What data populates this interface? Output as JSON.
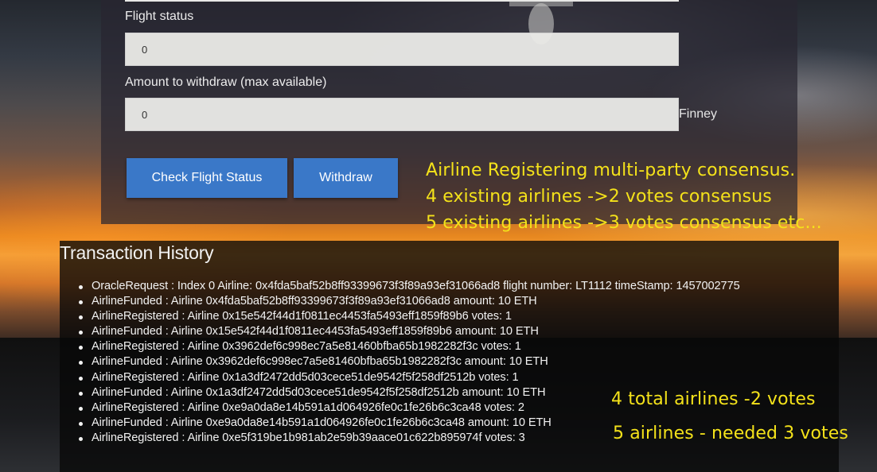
{
  "form": {
    "flight_status_label": "Flight status",
    "flight_status_value": "0",
    "withdraw_label": "Amount to withdraw (max available)",
    "withdraw_value": "0",
    "withdraw_unit": "Finney",
    "check_button_label": "Check Flight Status",
    "withdraw_button_label": "Withdraw"
  },
  "annotations": {
    "consensus_lines": [
      "Airline Registering multi-party consensus.",
      "4 existing airlines ->2 votes consensus",
      "5 existing airlines ->3 votes consensus etc..."
    ],
    "note_four": "4 total airlines -2 votes",
    "note_five": "5 airlines - needed 3 votes"
  },
  "history": {
    "title": "Transaction History",
    "items": [
      "OracleRequest : Index 0 Airline: 0x4fda5baf52b8ff93399673f3f89a93ef31066ad8 flight number: LT1112 timeStamp: 1457002775",
      "AirlineFunded : Airline 0x4fda5baf52b8ff93399673f3f89a93ef31066ad8 amount: 10 ETH",
      "AirlineRegistered : Airline 0x15e542f44d1f0811ec4453fa5493eff1859f89b6 votes: 1",
      "AirlineFunded : Airline 0x15e542f44d1f0811ec4453fa5493eff1859f89b6 amount: 10 ETH",
      "AirlineRegistered : Airline 0x3962def6c998ec7a5e81460bfba65b1982282f3c votes: 1",
      "AirlineFunded : Airline 0x3962def6c998ec7a5e81460bfba65b1982282f3c amount: 10 ETH",
      "AirlineRegistered : Airline 0x1a3df2472dd5d03cece51de9542f5f258df2512b votes: 1",
      "AirlineFunded : Airline 0x1a3df2472dd5d03cece51de9542f5f258df2512b amount: 10 ETH",
      "AirlineRegistered : Airline 0xe9a0da8e14b591a1d064926fe0c1fe26b6c3ca48 votes: 2",
      "AirlineFunded : Airline 0xe9a0da8e14b591a1d064926fe0c1fe26b6c3ca48 amount: 10 ETH",
      "AirlineRegistered : Airline 0xe5f319be1b981ab2e59b39aace01c622b895974f votes: 3"
    ]
  }
}
